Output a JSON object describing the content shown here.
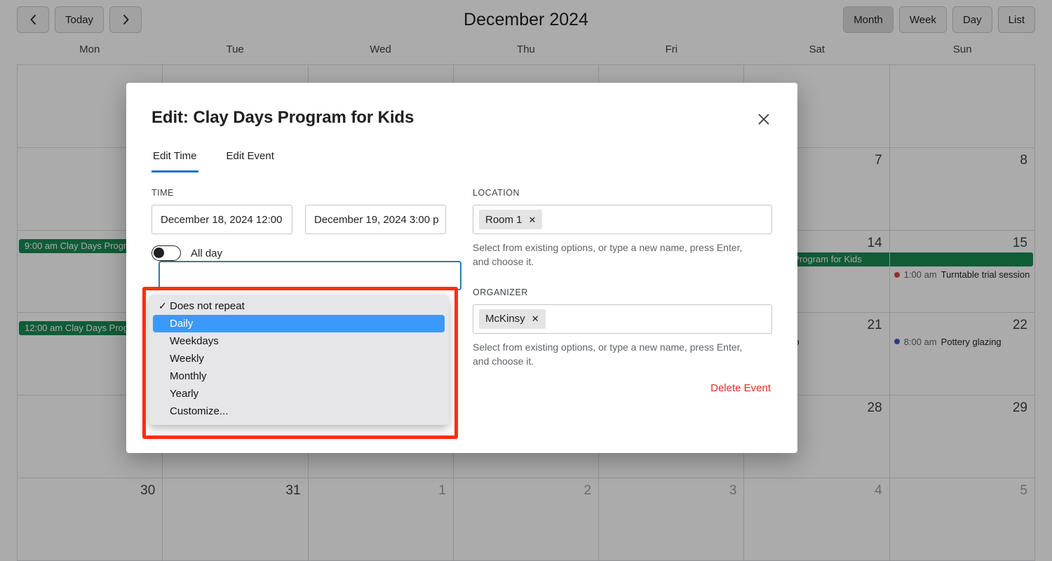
{
  "toolbar": {
    "prev_label": "‹",
    "today_label": "Today",
    "next_label": "›",
    "title": "December 2024",
    "views": [
      {
        "label": "Month",
        "active": true
      },
      {
        "label": "Week",
        "active": false
      },
      {
        "label": "Day",
        "active": false
      },
      {
        "label": "List",
        "active": false
      }
    ]
  },
  "calendar": {
    "day_headers": [
      "Mon",
      "Tue",
      "Wed",
      "Thu",
      "Fri",
      "Sat",
      "Sun"
    ],
    "weeks": [
      {
        "days": [
          {
            "num": "",
            "muted": false
          },
          {
            "num": "",
            "muted": false
          },
          {
            "num": "",
            "muted": false
          },
          {
            "num": "",
            "muted": false
          },
          {
            "num": "",
            "muted": false
          },
          {
            "num": "",
            "muted": false
          },
          {
            "num": "",
            "muted": false
          }
        ]
      },
      {
        "days": [
          {
            "num": "",
            "muted": false
          },
          {
            "num": "",
            "muted": false
          },
          {
            "num": "",
            "muted": false
          },
          {
            "num": "",
            "muted": false
          },
          {
            "num": "",
            "muted": false
          },
          {
            "num": "7",
            "muted": false
          },
          {
            "num": "8",
            "muted": false
          }
        ]
      },
      {
        "days": [
          {
            "num": "",
            "muted": false
          },
          {
            "num": "",
            "muted": false
          },
          {
            "num": "",
            "muted": false
          },
          {
            "num": "",
            "muted": false
          },
          {
            "num": "",
            "muted": false
          },
          {
            "num": "14",
            "muted": false
          },
          {
            "num": "15",
            "muted": false
          }
        ]
      },
      {
        "days": [
          {
            "num": "",
            "muted": false
          },
          {
            "num": "",
            "muted": false
          },
          {
            "num": "",
            "muted": false
          },
          {
            "num": "",
            "muted": false
          },
          {
            "num": "",
            "muted": false
          },
          {
            "num": "21",
            "muted": false
          },
          {
            "num": "22",
            "muted": false
          }
        ]
      },
      {
        "days": [
          {
            "num": "",
            "muted": false
          },
          {
            "num": "",
            "muted": false
          },
          {
            "num": "",
            "muted": false
          },
          {
            "num": "",
            "muted": false
          },
          {
            "num": "",
            "muted": false
          },
          {
            "num": "28",
            "muted": false
          },
          {
            "num": "29",
            "muted": false
          }
        ]
      },
      {
        "days": [
          {
            "num": "30",
            "muted": false
          },
          {
            "num": "31",
            "muted": false
          },
          {
            "num": "1",
            "muted": true
          },
          {
            "num": "2",
            "muted": true
          },
          {
            "num": "3",
            "muted": true
          },
          {
            "num": "4",
            "muted": true
          },
          {
            "num": "5",
            "muted": true
          }
        ]
      }
    ],
    "events": {
      "week3_mon": {
        "time": "9:00 am",
        "title": "Clay Days Program for Kids",
        "color": "#188a52"
      },
      "week3_sat_band": {
        "title": "Clay Days Program for Kids",
        "color": "#188a52"
      },
      "week3_sun_dot": {
        "time": "1:00 am",
        "title": "Turntable trial session",
        "dot": "#d64b41"
      },
      "week4_mon": {
        "time": "12:00 am",
        "title": "Clay Days Program for Kids",
        "color": "#188a52"
      },
      "week4_sat_dot": {
        "time": "",
        "title": "Ceramics workshop",
        "dot": "#d64b41"
      },
      "week4_sun_dot": {
        "time": "8:00 am",
        "title": "Pottery glazing",
        "dot": "#4159c4"
      }
    }
  },
  "modal": {
    "title": "Edit: Clay Days Program for Kids",
    "close_icon": "close-icon",
    "tabs": [
      {
        "label": "Edit Time",
        "active": true
      },
      {
        "label": "Edit Event",
        "active": false
      }
    ],
    "time": {
      "label": "TIME",
      "start_value": "December 18, 2024 12:00 ",
      "end_value": "December 19, 2024 3:00 p",
      "all_day_label": "All day",
      "all_day_on": false
    },
    "repeat": {
      "options": [
        {
          "label": "Does not repeat",
          "checked": true,
          "selected": false
        },
        {
          "label": "Daily",
          "checked": false,
          "selected": true
        },
        {
          "label": "Weekdays",
          "checked": false,
          "selected": false
        },
        {
          "label": "Weekly",
          "checked": false,
          "selected": false
        },
        {
          "label": "Monthly",
          "checked": false,
          "selected": false
        },
        {
          "label": "Yearly",
          "checked": false,
          "selected": false
        },
        {
          "label": "Customize...",
          "checked": false,
          "selected": false
        }
      ],
      "check_glyph": "✓"
    },
    "location": {
      "label": "LOCATION",
      "chip": "Room 1",
      "chip_remove": "✕",
      "helper": "Select from existing options, or type a new name, press Enter, and choose it."
    },
    "organizer": {
      "label": "ORGANIZER",
      "chip": "McKinsy",
      "chip_remove": "✕",
      "helper": "Select from existing options, or type a new name, press Enter, and choose it."
    },
    "delete_label": "Delete Event"
  },
  "colors": {
    "accent": "#1a73c7",
    "danger": "#d93025",
    "event_green": "#188a52",
    "highlight_blue": "#3b99fc",
    "annotation_red": "#ff2d0f"
  }
}
